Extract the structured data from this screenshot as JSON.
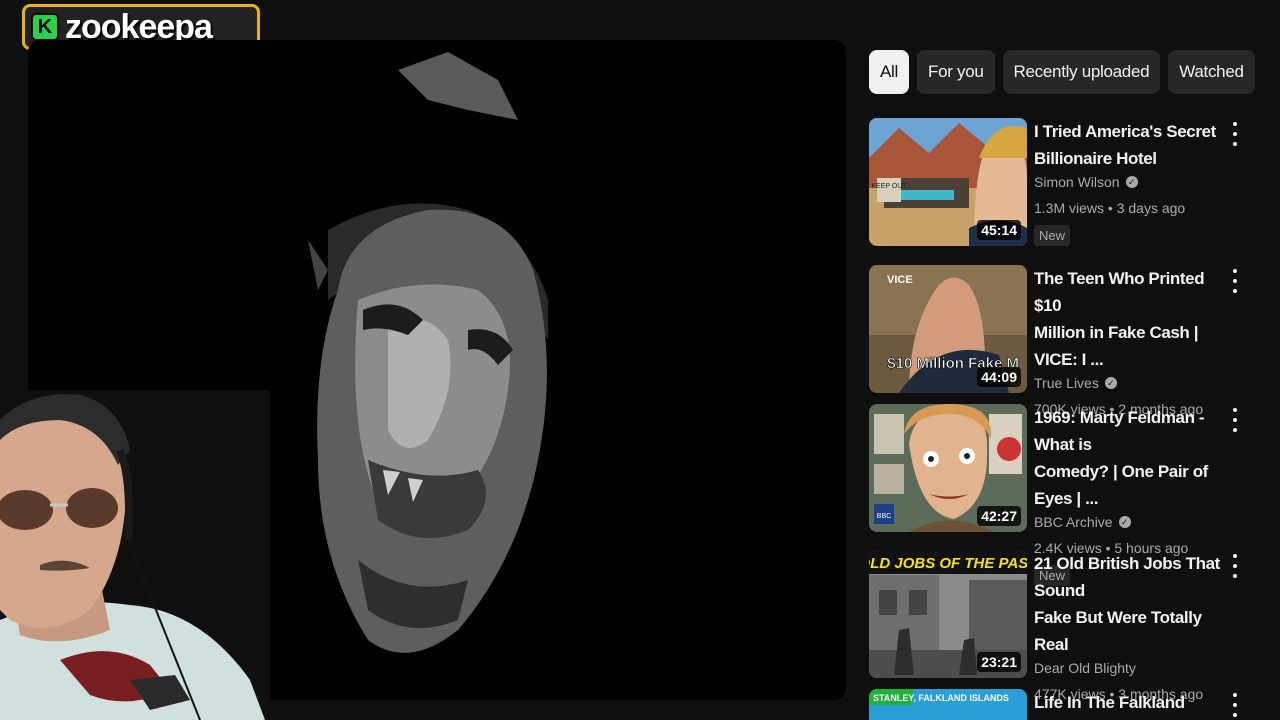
{
  "overlay": {
    "logo_letter": "K",
    "logo_text": "zookeepa"
  },
  "chips": [
    "All",
    "For you",
    "Recently uploaded",
    "Watched"
  ],
  "active_chip": "All",
  "videos": [
    {
      "title_line1": "I Tried America's Secret",
      "title_line2": "Billionaire Hotel",
      "channel": "Simon Wilson",
      "verified": true,
      "stats": "1.3M views • 3 days ago",
      "badge": "New",
      "duration": "45:14",
      "thumb_text": "KEEP OUT"
    },
    {
      "title_line1": "The Teen Who Printed $10",
      "title_line2": "Million in Fake Cash | VICE: I ...",
      "channel": "True Lives",
      "verified": true,
      "stats": "700K views • 2 months ago",
      "badge": "",
      "duration": "44:09",
      "thumb_text": "$10 Million Fake M",
      "thumb_logo": "VICE"
    },
    {
      "title_line1": "1969: Marty Feldman - What is",
      "title_line2": "Comedy? | One Pair of Eyes | ...",
      "channel": "BBC Archive",
      "verified": true,
      "stats": "2.4K views • 5 hours ago",
      "badge": "New",
      "duration": "42:27",
      "thumb_logo": "BBC"
    },
    {
      "title_line1": "21 Old British Jobs That Sound",
      "title_line2": "Fake But Were Totally Real",
      "channel": "Dear Old Blighty",
      "verified": false,
      "stats": "477K views • 3 months ago",
      "badge": "",
      "duration": "23:21",
      "thumb_text": "OLD JOBS OF THE PAST"
    },
    {
      "title_line1": "Life In The Falkland Islands'",
      "title_line2": "",
      "channel": "",
      "verified": false,
      "stats": "",
      "badge": "",
      "duration": "",
      "thumb_text": "STANLEY, FALKLAND ISLANDS"
    }
  ],
  "colors": {
    "background": "#0f0f0f",
    "chip": "#272727",
    "logo_border": "#e8b020",
    "logo_k": "#2bd14b"
  }
}
